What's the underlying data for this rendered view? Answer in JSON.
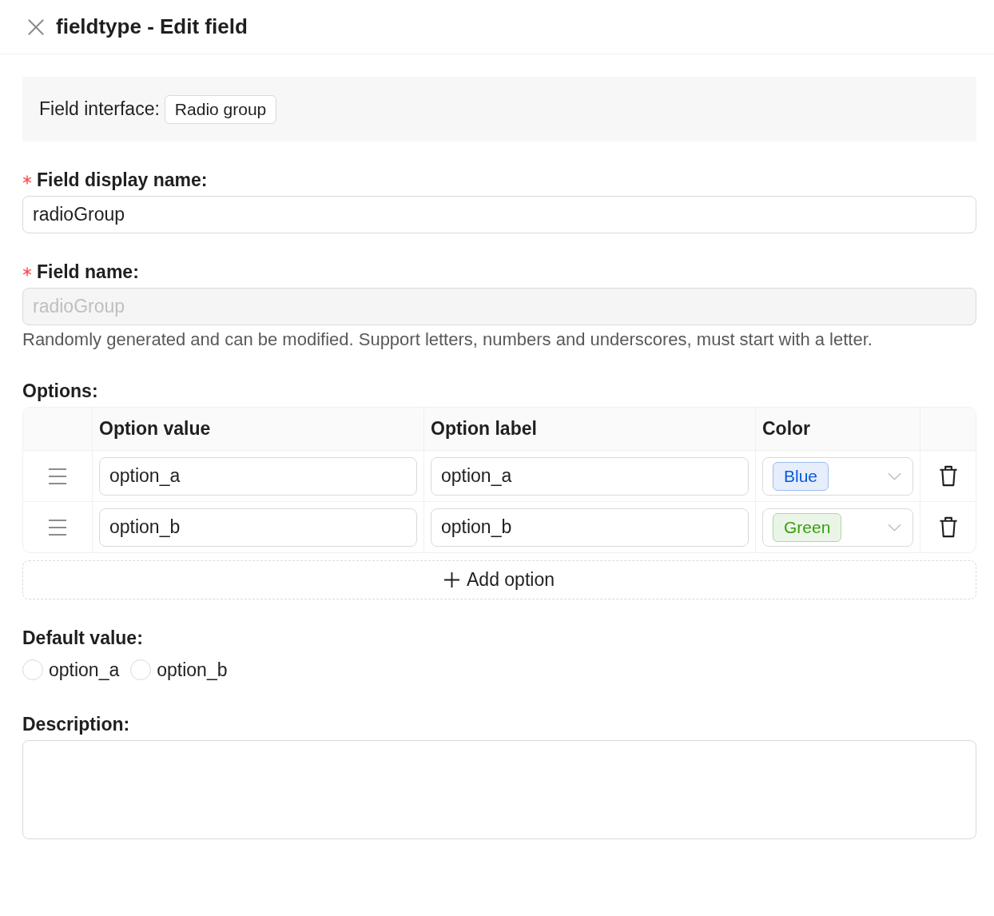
{
  "header": {
    "title": "fieldtype - Edit field"
  },
  "field_interface": {
    "label": "Field interface:",
    "value": "Radio group"
  },
  "display_name": {
    "label": "Field display name:",
    "required": true,
    "value": "radioGroup"
  },
  "field_name": {
    "label": "Field name:",
    "required": true,
    "value": "radioGroup",
    "disabled": true,
    "help": "Randomly generated and can be modified. Support letters, numbers and underscores, must start with a letter."
  },
  "options": {
    "label": "Options:",
    "columns": [
      "Option value",
      "Option label",
      "Color"
    ],
    "rows": [
      {
        "value": "option_a",
        "label": "option_a",
        "color_name": "Blue",
        "color": "#0958d9"
      },
      {
        "value": "option_b",
        "label": "option_b",
        "color_name": "Green",
        "color": "#389e0d"
      }
    ],
    "add_button": "Add option"
  },
  "default_value": {
    "label": "Default value:",
    "choices": [
      {
        "label": "option_a",
        "selected": false
      },
      {
        "label": "option_b",
        "selected": false
      }
    ]
  },
  "description": {
    "label": "Description:"
  }
}
